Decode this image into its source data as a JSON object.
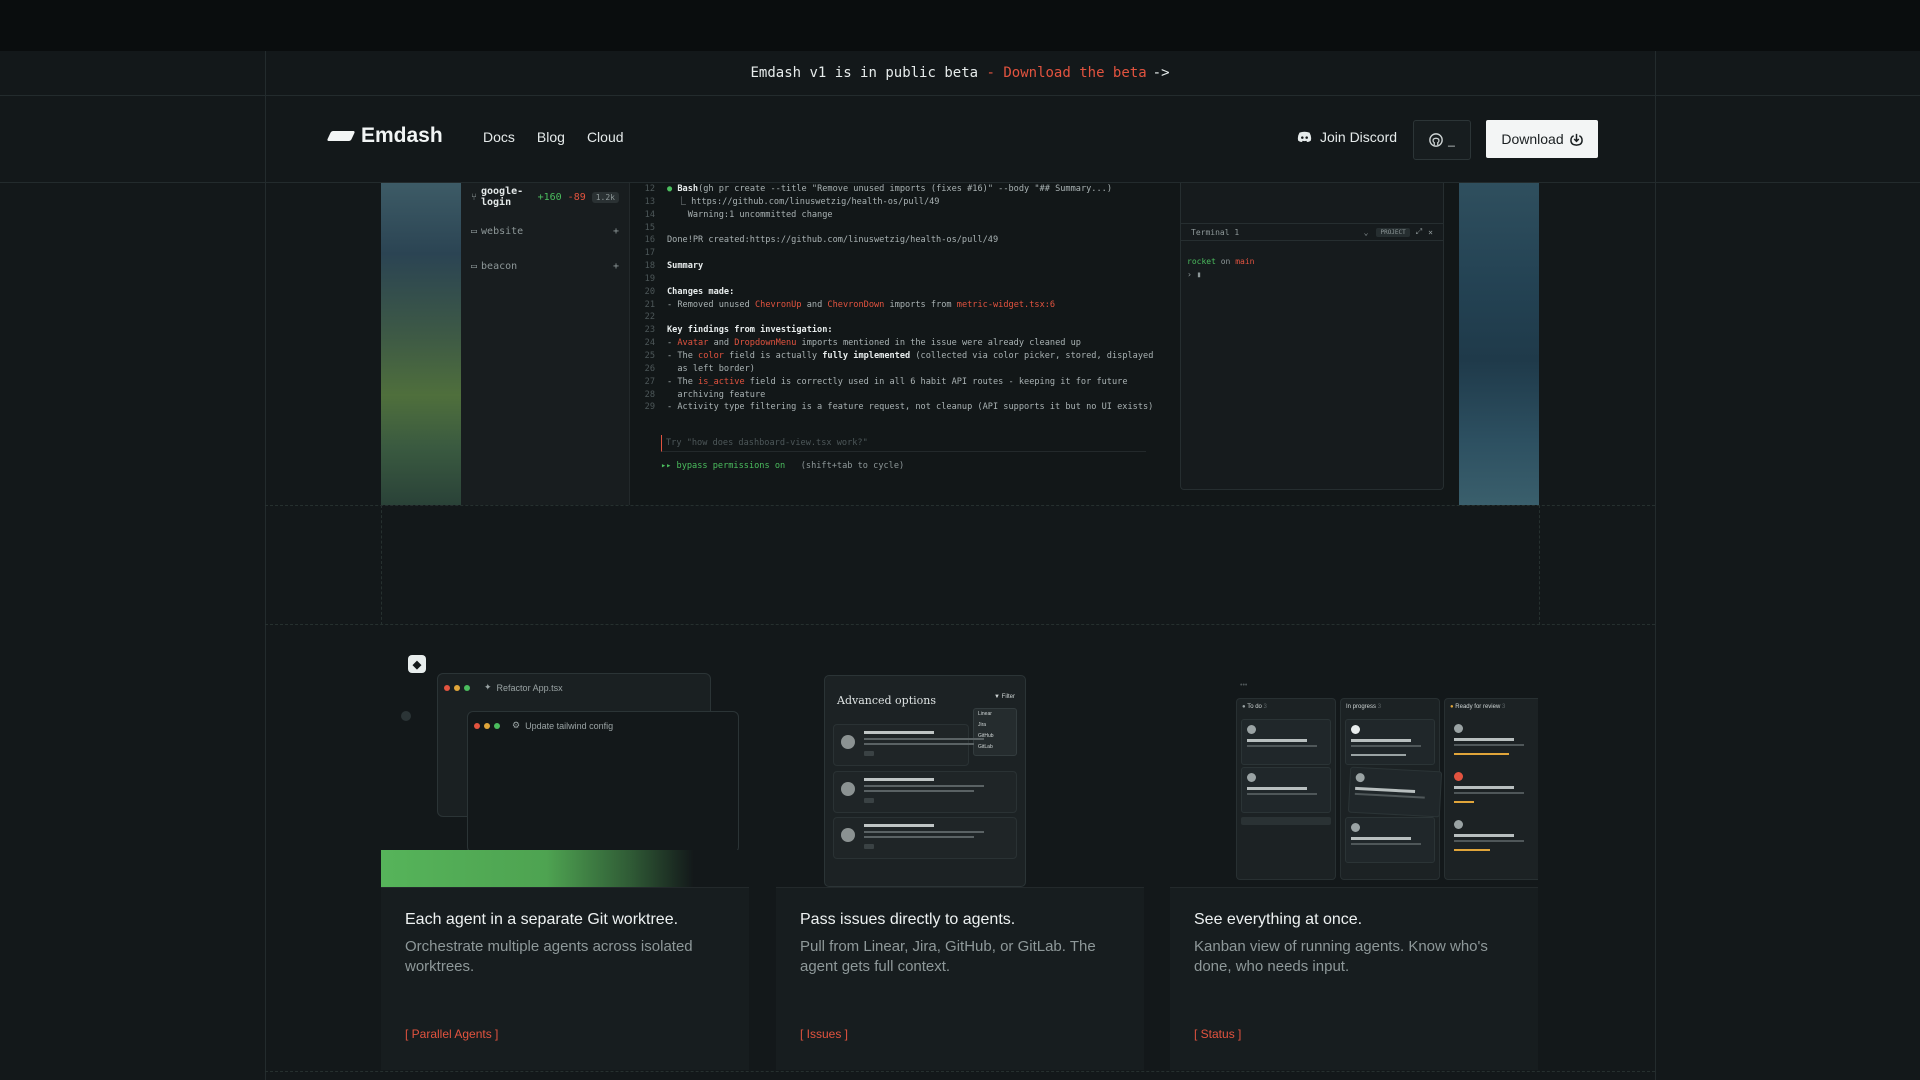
{
  "banner": {
    "text": "Emdash v1 is in public beta",
    "sep": " - ",
    "link": "Download the beta",
    "arrow": "->"
  },
  "nav": {
    "brand": "Emdash",
    "links": [
      "Docs",
      "Blog",
      "Cloud"
    ],
    "discord": "Join Discord",
    "github_suffix": "_",
    "download": "Download"
  },
  "hero": {
    "sidebar": {
      "branch": "google-login",
      "added": "+160",
      "removed": "-89",
      "badge": "1.2k",
      "projects": [
        "website",
        "beacon"
      ]
    },
    "code_lines": [
      {
        "n": "12",
        "html": "<span class='g'>●</span> <b>Bash</b>(gh pr create --title \"Remove unused imports (fixes #16)\" --body \"## Summary...)"
      },
      {
        "n": "13",
        "html": "&nbsp;&nbsp;⎿ https://github.com/linuswetzig/health-os/pull/49"
      },
      {
        "n": "14",
        "html": "&nbsp;&nbsp;&nbsp;&nbsp;Warning:1 uncommitted change"
      },
      {
        "n": "15",
        "html": ""
      },
      {
        "n": "16",
        "html": "Done!PR created:https://github.com/linuswetzig/health-os/pull/49"
      },
      {
        "n": "17",
        "html": ""
      },
      {
        "n": "18",
        "html": "<b>Summary</b>"
      },
      {
        "n": "19",
        "html": ""
      },
      {
        "n": "20",
        "html": "<b>Changes made:</b>"
      },
      {
        "n": "21",
        "html": "- Removed unused <span class='r'>ChevronUp</span> and <span class='r'>ChevronDown</span> imports from <span class='r'>metric-widget.tsx:6</span>"
      },
      {
        "n": "22",
        "html": ""
      },
      {
        "n": "23",
        "html": "<b>Key findings from investigation:</b>"
      },
      {
        "n": "24",
        "html": "- <span class='r'>Avatar</span> and <span class='r'>DropdownMenu</span> imports mentioned in the issue were already cleaned up"
      },
      {
        "n": "25",
        "html": "- The <span class='r'>color</span> field is actually <b>fully implemented</b> (collected via color picker, stored, displayed"
      },
      {
        "n": "26",
        "html": "&nbsp;&nbsp;as left border)"
      },
      {
        "n": "27",
        "html": "- The <span class='r'>is_active</span> field is correctly used in all 6 habit API routes - keeping it for future"
      },
      {
        "n": "28",
        "html": "&nbsp;&nbsp;archiving feature"
      },
      {
        "n": "29",
        "html": "- Activity type filtering is a feature request, not cleanup (API supports it but no UI exists)"
      }
    ],
    "prompt_placeholder": "Try \"how does dashboard-view.tsx work?\"",
    "bypass_on": "▸▸ bypass permissions on",
    "bypass_hint": "(shift+tab to cycle)",
    "terminal": {
      "title": "Terminal 1",
      "project_badge": "PROJECT",
      "dir": "rocket",
      "on": "on",
      "branch": "main",
      "prompt": "› ▮"
    }
  },
  "cards": [
    {
      "title": "Each agent in a separate Git worktree.",
      "desc": "Orchestrate multiple agents across isolated worktrees.",
      "tag": "[ Parallel Agents ]",
      "mock": {
        "tab1": "Refactor App.tsx",
        "tab2": "Update tailwind config"
      }
    },
    {
      "title": "Pass issues directly to agents.",
      "desc": "Pull from Linear, Jira, GitHub, or GitLab. The agent gets full context.",
      "tag": "[ Issues ]",
      "mock": {
        "heading": "Advanced options",
        "filter": "Filter",
        "sources": [
          "Linear",
          "Jira",
          "GitHub",
          "GitLab"
        ]
      }
    },
    {
      "title": "See everything at once.",
      "desc": "Kanban view of running agents. Know who's done, who needs input.",
      "tag": "[ Status ]",
      "mock": {
        "columns": [
          "To do",
          "In progress",
          "Ready for review"
        ],
        "counts": [
          "3",
          "3",
          "3"
        ]
      }
    }
  ],
  "colors": {
    "accent_red": "#e2533f",
    "accent_green": "#4bbd5e",
    "background": "#13181a"
  }
}
